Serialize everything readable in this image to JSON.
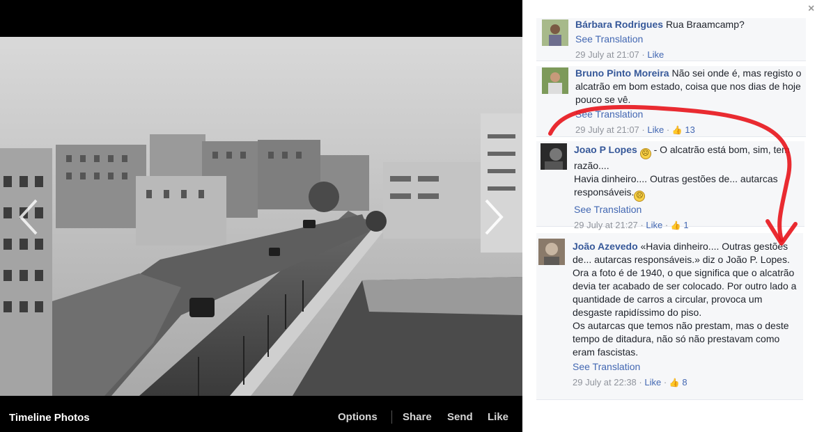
{
  "viewer": {
    "album_title": "Timeline Photos",
    "actions": {
      "options": "Options",
      "share": "Share",
      "send": "Send",
      "like": "Like"
    }
  },
  "panel": {
    "close_glyph": "×",
    "comments": [
      {
        "author": "Bárbara Rodrigues",
        "text": "Rua Braamcamp?",
        "see_translation": "See Translation",
        "timestamp": "29 July at 21:07",
        "like": "Like",
        "likes": ""
      },
      {
        "author": "Bruno Pinto Moreira",
        "text": "Não sei onde é, mas registo o alcatrão em bom estado, coisa que nos dias de hoje pouco se vê.",
        "see_translation": "See Translation",
        "timestamp": "29 July at 21:07",
        "like": "Like",
        "likes": "13"
      },
      {
        "author": "Joao P Lopes",
        "text_after_emoji": "- O alcatrão está bom, sim, tem razão....",
        "text_line2": "Havia dinheiro.... Outras gestões de... autarcas responsáveis.",
        "see_translation": "See Translation",
        "timestamp": "29 July at 21:27",
        "like": "Like",
        "likes": "1"
      },
      {
        "author": "João Azevedo",
        "text": "«Havia dinheiro.... Outras gestões de... autarcas responsáveis.» diz o João P. Lopes.\nOra a foto é de 1940, o que significa que o alcatrão devia ter acabado de ser colocado. Por outro lado a quantidade de carros a circular, provoca um desgaste rapidíssimo do piso.\nOs autarcas que temos não prestam, mas o deste tempo de ditadura, não só não prestavam como eram fascistas.",
        "see_translation": "See Translation",
        "timestamp": "29 July at 22:38",
        "like": "Like",
        "likes": "8"
      }
    ]
  },
  "icons": {
    "prev": "chevron-left-icon",
    "next": "chevron-right-icon",
    "close": "close-icon",
    "thumb": "thumbs-up-icon",
    "emoji": "sad-face-icon"
  },
  "colors": {
    "link": "#365899",
    "meta": "#90949c",
    "panel_bg": "#f6f7f9",
    "annotation": "#e8141b"
  }
}
